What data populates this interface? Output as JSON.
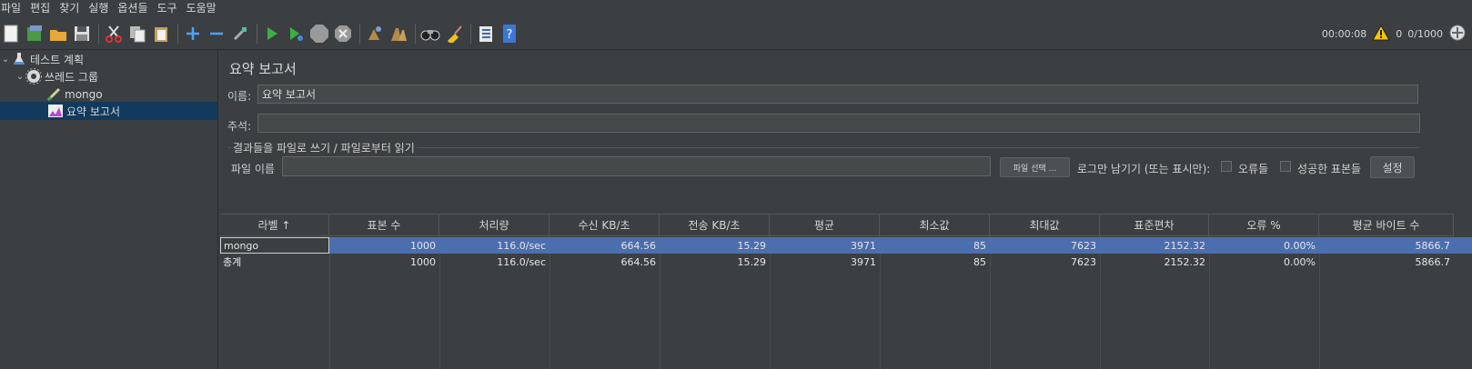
{
  "menu": [
    "파일",
    "편집",
    "찾기",
    "실행",
    "옵션들",
    "도구",
    "도움말"
  ],
  "toolbar": {
    "icons": [
      "new-icon",
      "templates-icon",
      "open-icon",
      "save-icon",
      "cut-icon",
      "copy-icon",
      "paste-icon",
      "expand-icon",
      "collapse-icon",
      "toggle-icon",
      "start-icon",
      "start-no-pause-icon",
      "stop-icon",
      "shutdown-icon",
      "clear-icon",
      "clear-all-icon",
      "search-icon",
      "reset-search-icon",
      "function-helper-icon",
      "help-icon"
    ],
    "timer": "00:00:08",
    "warning_count": "0",
    "threads": "0/1000"
  },
  "tree": {
    "items": [
      {
        "label": "테스트 계획",
        "icon": "flask-icon"
      },
      {
        "label": "쓰레드 그룹",
        "icon": "gear-icon"
      },
      {
        "label": "mongo",
        "icon": "sampler-pen-icon"
      },
      {
        "label": "요약 보고서",
        "icon": "report-icon"
      }
    ]
  },
  "panel": {
    "title": "요약 보고서",
    "name_label": "이름:",
    "name_value": "요약 보고서",
    "comment_label": "주석:",
    "comment_value": "",
    "group_title": "결과들을 파일로 쓰기 / 파일로부터 읽기",
    "file_label": "파일 이름",
    "file_value": "",
    "browse_label": "파일 선택 ...",
    "log_only_label": "로그만 남기기 (또는 표시만):",
    "errors_label": "오류들",
    "success_label": "성공한 표본들",
    "config_label": "설정"
  },
  "table": {
    "columns": [
      "라벨 ↑",
      "표본 수",
      "처리량",
      "수신 KB/초",
      "전송 KB/초",
      "평균",
      "최소값",
      "최대값",
      "표준편차",
      "오류 %",
      "평균 바이트 수"
    ],
    "rows": [
      [
        "mongo",
        "1000",
        "116.0/sec",
        "664.56",
        "15.29",
        "3971",
        "85",
        "7623",
        "2152.32",
        "0.00%",
        "5866.7"
      ],
      [
        "총계",
        "1000",
        "116.0/sec",
        "664.56",
        "15.29",
        "3971",
        "85",
        "7623",
        "2152.32",
        "0.00%",
        "5866.7"
      ]
    ]
  }
}
